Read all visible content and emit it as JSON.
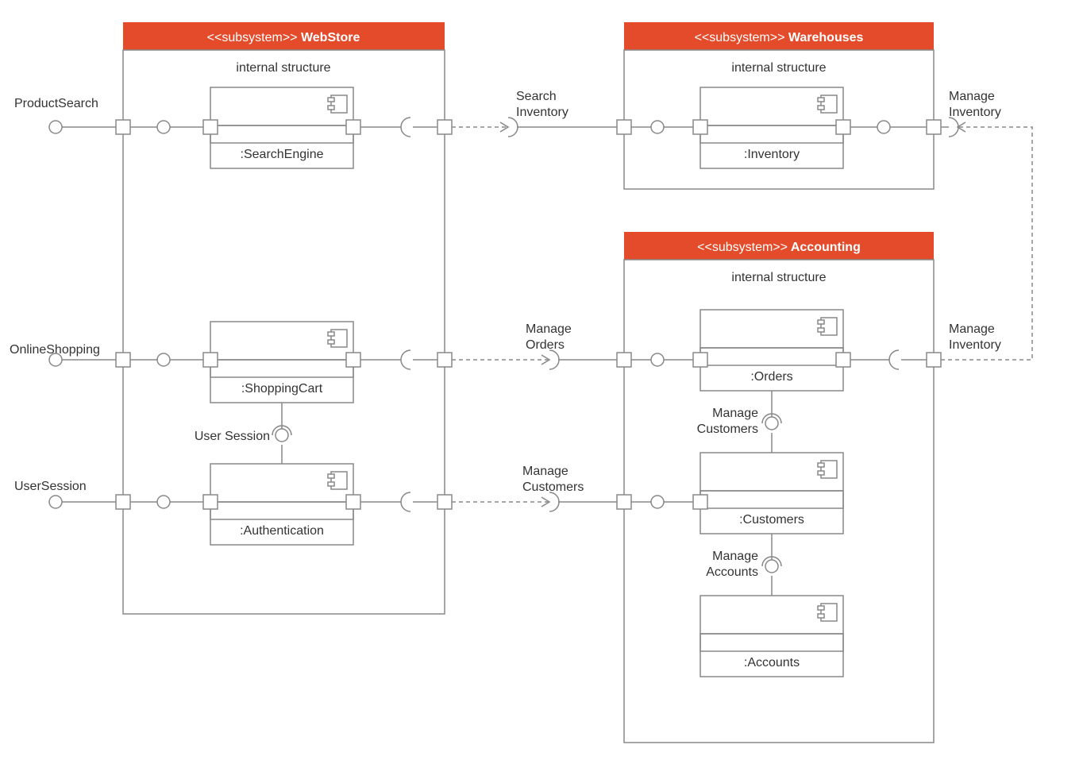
{
  "stereotype": "<<subsystem>>",
  "internal_label": "internal structure",
  "subsystems": {
    "webstore": {
      "title": "WebStore",
      "components": [
        "SearchEngine",
        "ShoppingCart",
        "Authentication"
      ]
    },
    "warehouses": {
      "title": "Warehouses",
      "components": [
        "Inventory"
      ]
    },
    "accounting": {
      "title": "Accounting",
      "components": [
        "Orders",
        "Customers",
        "Accounts"
      ]
    }
  },
  "external_interfaces": {
    "product_search": "ProductSearch",
    "online_shopping": "OnlineShopping",
    "user_session": "UserSession"
  },
  "link_labels": {
    "search_inventory_1": "Search",
    "search_inventory_2": "Inventory",
    "manage_orders_1": "Manage",
    "manage_orders_2": "Orders",
    "manage_customers_1": "Manage",
    "manage_customers_2": "Customers",
    "manage_inventory_1": "Manage",
    "manage_inventory_2": "Inventory",
    "user_session_internal": "User Session",
    "manage_customers_int_1": "Manage",
    "manage_customers_int_2": "Customers",
    "manage_accounts_1": "Manage",
    "manage_accounts_2": "Accounts"
  },
  "colors": {
    "header_bg": "#e34b2a",
    "stroke": "#888"
  }
}
